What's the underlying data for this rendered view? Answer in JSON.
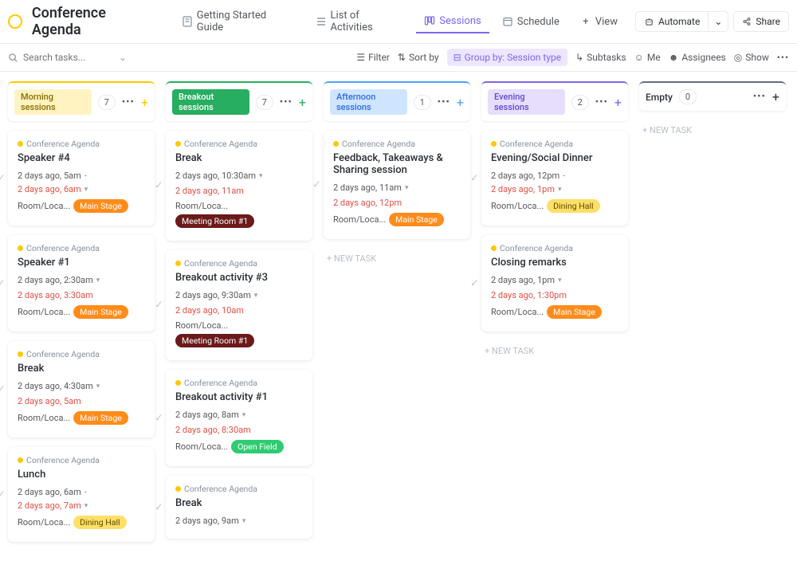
{
  "header": {
    "title": "Conference Agenda",
    "nav": [
      {
        "label": "Getting Started Guide"
      },
      {
        "label": "List of Activities"
      },
      {
        "label": "Sessions"
      },
      {
        "label": "Schedule"
      },
      {
        "label": "View"
      }
    ],
    "automate": "Automate",
    "share": "Share"
  },
  "toolbar": {
    "search_placeholder": "Search tasks...",
    "filter": "Filter",
    "sort": "Sort by",
    "group": "Group by: Session type",
    "subtasks": "Subtasks",
    "me": "Me",
    "assignees": "Assignees",
    "show": "Show"
  },
  "new_task_label": "+ NEW TASK",
  "location_label": "Room/Loca...",
  "crumb": "Conference Agenda",
  "columns": [
    {
      "id": "morning",
      "label": "Morning sessions",
      "count": "7",
      "theme": "yellow",
      "cards": [
        {
          "title": "Speaker #4",
          "time": "2 days ago, 5am",
          "end": "2 days ago, 6am",
          "loc_pill": "Main Stage",
          "pill_color": "orange"
        },
        {
          "title": "Speaker #1",
          "time": "2 days ago, 2:30am",
          "due": "2 days ago, 3:30am",
          "loc_pill": "Main Stage",
          "pill_color": "orange"
        },
        {
          "title": "Break",
          "time": "2 days ago, 4:30am",
          "due": "2 days ago, 5am",
          "loc_pill": "Main Stage",
          "pill_color": "orange"
        },
        {
          "title": "Lunch",
          "time": "2 days ago, 6am",
          "end": "2 days ago, 7am",
          "loc_pill": "Dining Hall",
          "pill_color": "yellow"
        }
      ]
    },
    {
      "id": "breakout",
      "label": "Breakout sessions",
      "count": "7",
      "theme": "green",
      "cards": [
        {
          "title": "Break",
          "time": "2 days ago, 10:30am",
          "due": "2 days ago, 11am",
          "loc_pill": "Meeting Room #1",
          "pill_color": "maroon"
        },
        {
          "title": "Breakout activity #3",
          "time": "2 days ago, 9:30am",
          "due": "2 days ago, 10am",
          "loc_pill": "Meeting Room #1",
          "pill_color": "maroon"
        },
        {
          "title": "Breakout activity #1",
          "time": "2 days ago, 8am",
          "due": "2 days ago, 8:30am",
          "loc_pill": "Open Field",
          "pill_color": "green"
        },
        {
          "title": "Break",
          "time": "2 days ago, 9am"
        }
      ]
    },
    {
      "id": "afternoon",
      "label": "Afternoon sessions",
      "count": "1",
      "theme": "blue",
      "cards": [
        {
          "title": "Feedback, Takeaways & Sharing session",
          "time": "2 days ago, 11am",
          "due": "2 days ago, 12pm",
          "loc_pill": "Main Stage",
          "pill_color": "orange"
        }
      ],
      "show_new": true
    },
    {
      "id": "evening",
      "label": "Evening sessions",
      "count": "2",
      "theme": "purple",
      "cards": [
        {
          "title": "Evening/Social Dinner",
          "time": "2 days ago, 12pm",
          "end": "2 days ago, 1pm",
          "loc_pill": "Dining Hall",
          "pill_color": "yellow"
        },
        {
          "title": "Closing remarks",
          "time": "2 days ago, 1pm",
          "due": "2 days ago, 1:30pm",
          "loc_pill": "Main Stage",
          "pill_color": "orange"
        }
      ],
      "show_new": true
    },
    {
      "id": "empty",
      "label": "Empty",
      "count": "0",
      "theme": "gray",
      "cards": [],
      "show_new": true
    }
  ]
}
